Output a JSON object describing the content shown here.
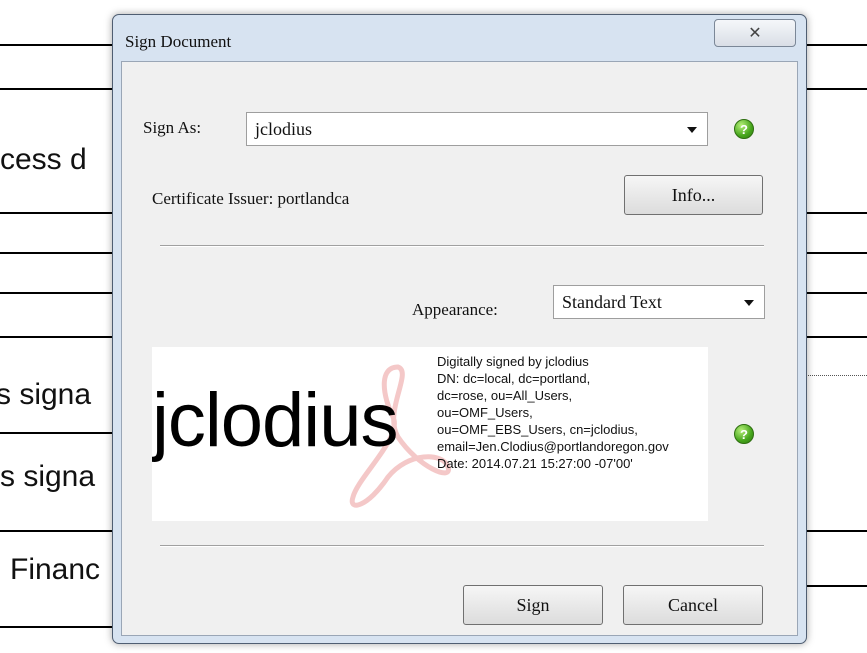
{
  "background": {
    "text_fragments": [
      "cess d",
      "s signa",
      "s signa",
      "Financ"
    ]
  },
  "dialog": {
    "title": "Sign Document",
    "close_glyph": "✕",
    "sign_as": {
      "label": "Sign As:",
      "value": "jclodius"
    },
    "certificate_issuer": "Certificate Issuer: portlandca",
    "info_button": "Info...",
    "appearance": {
      "label": "Appearance:",
      "value": "Standard Text"
    },
    "preview": {
      "name": "jclodius",
      "details": [
        "Digitally signed by jclodius",
        "DN: dc=local, dc=portland,",
        "dc=rose, ou=All_Users,",
        "ou=OMF_Users,",
        "ou=OMF_EBS_Users, cn=jclodius,",
        "email=Jen.Clodius@portlandoregon.gov",
        "Date: 2014.07.21 15:27:00 -07'00'"
      ]
    },
    "help_glyph": "?",
    "sign_button": "Sign",
    "cancel_button": "Cancel"
  },
  "colors": {
    "help_icon": "#46a51c",
    "window_frame": "#d7e3f1",
    "watermark": "#f4c8c8"
  },
  "icons": [
    "close-icon",
    "dropdown-arrow-icon",
    "help-icon",
    "acrobat-watermark-icon"
  ]
}
